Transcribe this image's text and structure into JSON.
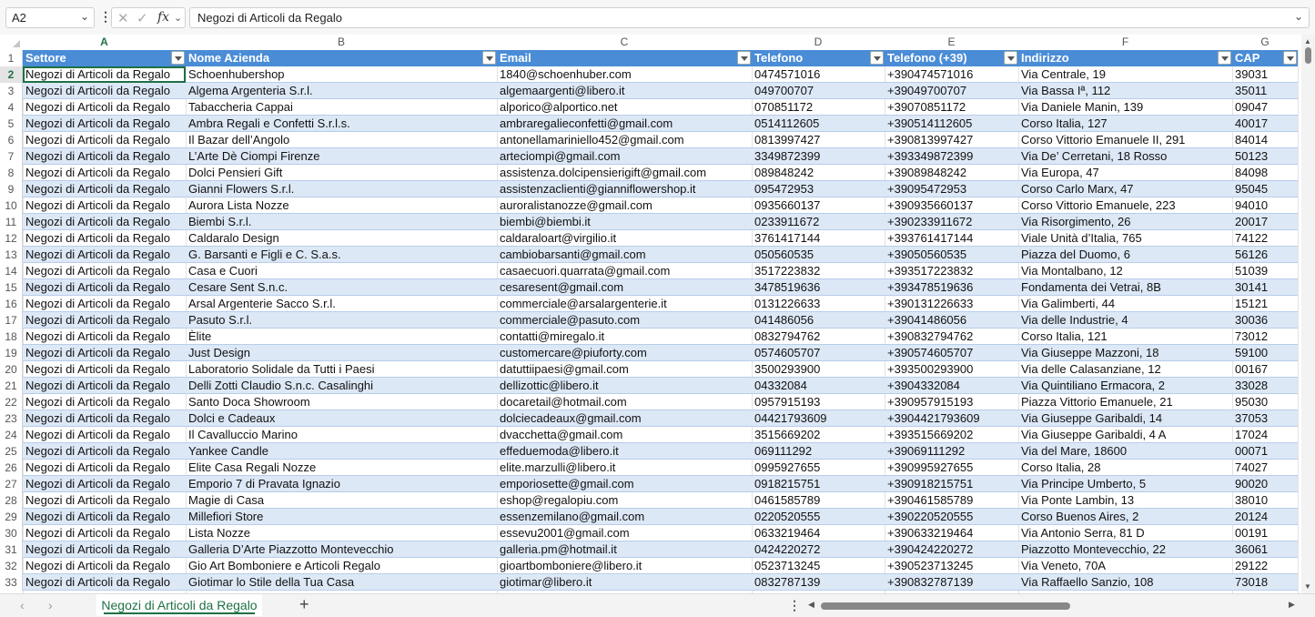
{
  "formula_bar": {
    "name_box": "A2",
    "formula": "Negozi di Articoli da Regalo",
    "fx_label": "fx"
  },
  "columns": [
    "A",
    "B",
    "C",
    "D",
    "E",
    "F",
    "G"
  ],
  "headers": [
    "Settore",
    "Nome Azienda",
    "Email",
    "Telefono",
    "Telefono (+39)",
    "Indirizzo",
    "CAP"
  ],
  "rows": [
    [
      "Negozi di Articoli da Regalo",
      "Schoenhubershop",
      "1840@schoenhuber.com",
      "0474571016",
      "+390474571016",
      "Via Centrale, 19",
      "39031"
    ],
    [
      "Negozi di Articoli da Regalo",
      "Algema Argenteria S.r.l.",
      "algemaargenti@libero.it",
      "049700707",
      "+39049700707",
      "Via Bassa Iª, 112",
      "35011"
    ],
    [
      "Negozi di Articoli da Regalo",
      "Tabaccheria Cappai",
      "alporico@alportico.net",
      "070851172",
      "+39070851172",
      "Via Daniele Manin, 139",
      "09047"
    ],
    [
      "Negozi di Articoli da Regalo",
      "Ambra Regali e Confetti S.r.l.s.",
      "ambraregalieconfetti@gmail.com",
      "0514112605",
      "+390514112605",
      "Corso Italia, 127",
      "40017"
    ],
    [
      "Negozi di Articoli da Regalo",
      "Il Bazar dell’Angolo",
      "antonellamariniello452@gmail.com",
      "0813997427",
      "+390813997427",
      "Corso Vittorio Emanuele II, 291",
      "84014"
    ],
    [
      "Negozi di Articoli da Regalo",
      "L’Arte Dè Ciompi Firenze",
      "arteciompi@gmail.com",
      "3349872399",
      "+393349872399",
      "Via De’ Cerretani, 18 Rosso",
      "50123"
    ],
    [
      "Negozi di Articoli da Regalo",
      "Dolci Pensieri Gift",
      "assistenza.dolcipensierigift@gmail.com",
      "089848242",
      "+39089848242",
      "Via Europa, 47",
      "84098"
    ],
    [
      "Negozi di Articoli da Regalo",
      "Gianni Flowers S.r.l.",
      "assistenzaclienti@gianniflowershop.it",
      "095472953",
      "+39095472953",
      "Corso Carlo Marx, 47",
      "95045"
    ],
    [
      "Negozi di Articoli da Regalo",
      "Aurora Lista Nozze",
      "auroralistanozze@gmail.com",
      "0935660137",
      "+390935660137",
      "Corso Vittorio Emanuele, 223",
      "94010"
    ],
    [
      "Negozi di Articoli da Regalo",
      "Biembi S.r.l.",
      "biembi@biembi.it",
      "0233911672",
      "+390233911672",
      "Via Risorgimento, 26",
      "20017"
    ],
    [
      "Negozi di Articoli da Regalo",
      "Caldaralo Design",
      "caldaraloart@virgilio.it",
      "3761417144",
      "+393761417144",
      "Viale Unità d’Italia, 765",
      "74122"
    ],
    [
      "Negozi di Articoli da Regalo",
      "G. Barsanti e Figli e C. S.a.s.",
      "cambiobarsanti@gmail.com",
      "050560535",
      "+39050560535",
      "Piazza del Duomo, 6",
      "56126"
    ],
    [
      "Negozi di Articoli da Regalo",
      "Casa e Cuori",
      "casaecuori.quarrata@gmail.com",
      "3517223832",
      "+393517223832",
      "Via Montalbano, 12",
      "51039"
    ],
    [
      "Negozi di Articoli da Regalo",
      "Cesare Sent S.n.c.",
      "cesaresent@gmail.com",
      "3478519636",
      "+393478519636",
      "Fondamenta dei Vetrai, 8B",
      "30141"
    ],
    [
      "Negozi di Articoli da Regalo",
      "Arsal Argenterie Sacco S.r.l.",
      "commerciale@arsalargenterie.it",
      "0131226633",
      "+390131226633",
      "Via Galimberti, 44",
      "15121"
    ],
    [
      "Negozi di Articoli da Regalo",
      "Pasuto S.r.l.",
      "commerciale@pasuto.com",
      "041486056",
      "+39041486056",
      "Via delle Industrie, 4",
      "30036"
    ],
    [
      "Negozi di Articoli da Regalo",
      "Èlite",
      "contatti@miregalo.it",
      "0832794762",
      "+390832794762",
      "Corso Italia, 121",
      "73012"
    ],
    [
      "Negozi di Articoli da Regalo",
      "Just Design",
      "customercare@piuforty.com",
      "0574605707",
      "+390574605707",
      "Via Giuseppe Mazzoni, 18",
      "59100"
    ],
    [
      "Negozi di Articoli da Regalo",
      "Laboratorio Solidale da Tutti i Paesi",
      "datuttiipaesi@gmail.com",
      "3500293900",
      "+393500293900",
      "Via delle Calasanziane, 12",
      "00167"
    ],
    [
      "Negozi di Articoli da Regalo",
      "Delli Zotti Claudio S.n.c. Casalinghi",
      "dellizottic@libero.it",
      "04332084",
      "+3904332084",
      "Via Quintiliano Ermacora, 2",
      "33028"
    ],
    [
      "Negozi di Articoli da Regalo",
      "Santo Doca Showroom",
      "docaretail@hotmail.com",
      "0957915193",
      "+390957915193",
      "Piazza Vittorio Emanuele, 21",
      "95030"
    ],
    [
      "Negozi di Articoli da Regalo",
      "Dolci e Cadeaux",
      "dolciecadeaux@gmail.com",
      "04421793609",
      "+3904421793609",
      "Via Giuseppe Garibaldi, 14",
      "37053"
    ],
    [
      "Negozi di Articoli da Regalo",
      "Il Cavalluccio Marino",
      "dvacchetta@gmail.com",
      "3515669202",
      "+393515669202",
      "Via Giuseppe Garibaldi, 4 A",
      "17024"
    ],
    [
      "Negozi di Articoli da Regalo",
      "Yankee Candle",
      "effeduemoda@libero.it",
      "069111292",
      "+39069111292",
      "Via del Mare, 18600",
      "00071"
    ],
    [
      "Negozi di Articoli da Regalo",
      "Elite Casa Regali Nozze",
      "elite.marzulli@libero.it",
      "0995927655",
      "+390995927655",
      "Corso Italia, 28",
      "74027"
    ],
    [
      "Negozi di Articoli da Regalo",
      "Emporio 7 di Pravata Ignazio",
      "emporiosette@gmail.com",
      "0918215751",
      "+390918215751",
      "Via Principe Umberto, 5",
      "90020"
    ],
    [
      "Negozi di Articoli da Regalo",
      "Magie di Casa",
      "eshop@regalopiu.com",
      "0461585789",
      "+390461585789",
      "Via Ponte Lambin, 13",
      "38010"
    ],
    [
      "Negozi di Articoli da Regalo",
      "Millefiori Store",
      "essenzemilano@gmail.com",
      "0220520555",
      "+390220520555",
      "Corso Buenos Aires, 2",
      "20124"
    ],
    [
      "Negozi di Articoli da Regalo",
      "Lista Nozze",
      "essevu2001@gmail.com",
      "0633219464",
      "+390633219464",
      "Via Antonio Serra, 81 D",
      "00191"
    ],
    [
      "Negozi di Articoli da Regalo",
      "Galleria D’Arte Piazzotto Montevecchio",
      "galleria.pm@hotmail.it",
      "0424220272",
      "+390424220272",
      "Piazzotto Montevecchio, 22",
      "36061"
    ],
    [
      "Negozi di Articoli da Regalo",
      "Gio Art Bomboniere e Articoli Regalo",
      "gioartbomboniere@libero.it",
      "0523713245",
      "+390523713245",
      "Via Veneto, 70A",
      "29122"
    ],
    [
      "Negozi di Articoli da Regalo",
      "Giotimar lo Stile della Tua Casa",
      "giotimar@libero.it",
      "0832787139",
      "+390832787139",
      "Via Raffaello Sanzio, 108",
      "73018"
    ]
  ],
  "sheet_tab": "Negozi di Articoli da Regalo",
  "icons": {
    "name_box_dropdown": "chevron-down-icon",
    "cancel": "close-icon",
    "confirm": "check-icon",
    "add_sheet": "plus-icon"
  },
  "colors": {
    "header_fill": "#4a8cd6",
    "band_fill": "#dde8f6",
    "accent": "#1e7145"
  }
}
